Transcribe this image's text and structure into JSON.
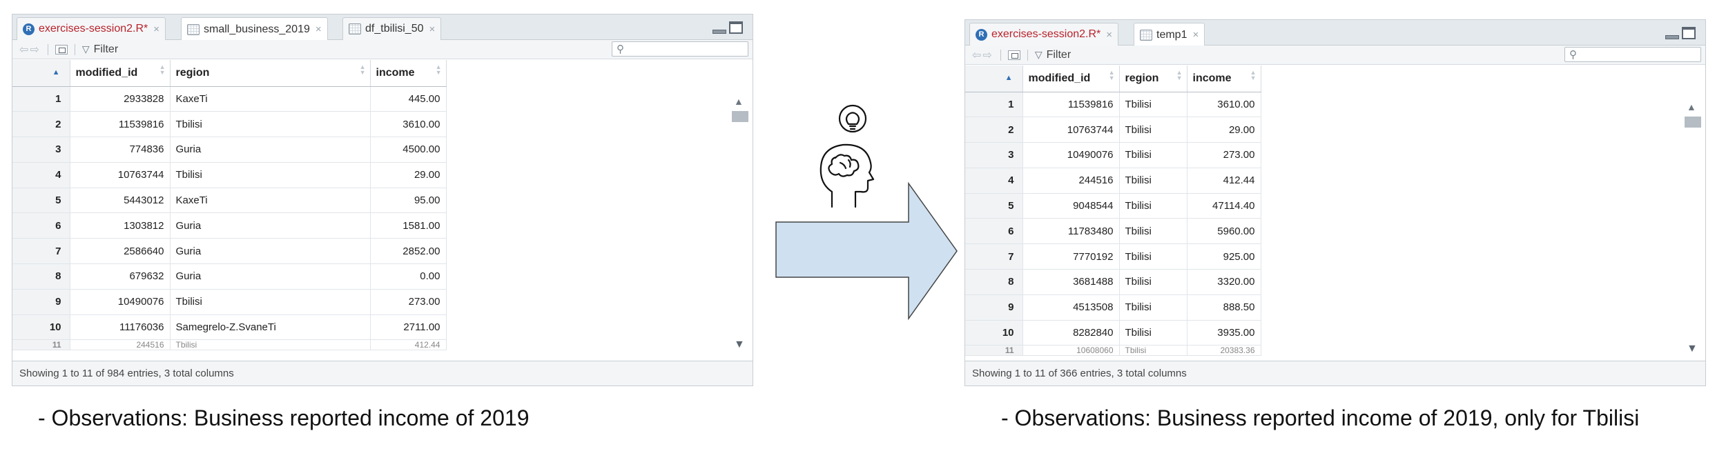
{
  "left_viewer": {
    "tabs": [
      {
        "label": "exercises-session2.R*",
        "icon": "r-script-icon",
        "close": "×"
      },
      {
        "label": "small_business_2019",
        "icon": "data-grid-icon",
        "close": "×"
      },
      {
        "label": "df_tbilisi_50",
        "icon": "data-grid-icon",
        "close": "×"
      }
    ],
    "filter_label": "Filter",
    "columns": [
      "",
      "modified_id",
      "region",
      "income"
    ],
    "rows": [
      [
        "1",
        "2933828",
        "KaxeTi",
        "445.00"
      ],
      [
        "2",
        "11539816",
        "Tbilisi",
        "3610.00"
      ],
      [
        "3",
        "774836",
        "Guria",
        "4500.00"
      ],
      [
        "4",
        "10763744",
        "Tbilisi",
        "29.00"
      ],
      [
        "5",
        "5443012",
        "KaxeTi",
        "95.00"
      ],
      [
        "6",
        "1303812",
        "Guria",
        "1581.00"
      ],
      [
        "7",
        "2586640",
        "Guria",
        "2852.00"
      ],
      [
        "8",
        "679632",
        "Guria",
        "0.00"
      ],
      [
        "9",
        "10490076",
        "Tbilisi",
        "273.00"
      ],
      [
        "10",
        "11176036",
        "Samegrelo-Z.SvaneTi",
        "2711.00"
      ]
    ],
    "partial_row": [
      "11",
      "244516",
      "Tbilisi",
      "412.44"
    ],
    "status": "Showing 1 to 11 of 984 entries, 3 total columns"
  },
  "right_viewer": {
    "tabs": [
      {
        "label": "exercises-session2.R*",
        "icon": "r-script-icon",
        "close": "×"
      },
      {
        "label": "temp1",
        "icon": "data-grid-icon",
        "close": "×"
      }
    ],
    "filter_label": "Filter",
    "columns": [
      "",
      "modified_id",
      "region",
      "income"
    ],
    "rows": [
      [
        "1",
        "11539816",
        "Tbilisi",
        "3610.00"
      ],
      [
        "2",
        "10763744",
        "Tbilisi",
        "29.00"
      ],
      [
        "3",
        "10490076",
        "Tbilisi",
        "273.00"
      ],
      [
        "4",
        "244516",
        "Tbilisi",
        "412.44"
      ],
      [
        "5",
        "9048544",
        "Tbilisi",
        "47114.40"
      ],
      [
        "6",
        "11783480",
        "Tbilisi",
        "5960.00"
      ],
      [
        "7",
        "7770192",
        "Tbilisi",
        "925.00"
      ],
      [
        "8",
        "3681488",
        "Tbilisi",
        "3320.00"
      ],
      [
        "9",
        "4513508",
        "Tbilisi",
        "888.50"
      ],
      [
        "10",
        "8282840",
        "Tbilisi",
        "3935.00"
      ]
    ],
    "partial_row": [
      "11",
      "10608060",
      "Tbilisi",
      "20383.36"
    ],
    "status": "Showing 1 to 11 of 366 entries, 3 total columns"
  },
  "captions": {
    "left": "- Observations: Business reported income of 2019",
    "right": "- Observations: Business reported income of 2019, only for Tbilisi"
  },
  "colors": {
    "arrow_fill": "#cfe0f1",
    "r_script_tab_text": "#b8222a",
    "sort_active": "#2f6fb5"
  }
}
